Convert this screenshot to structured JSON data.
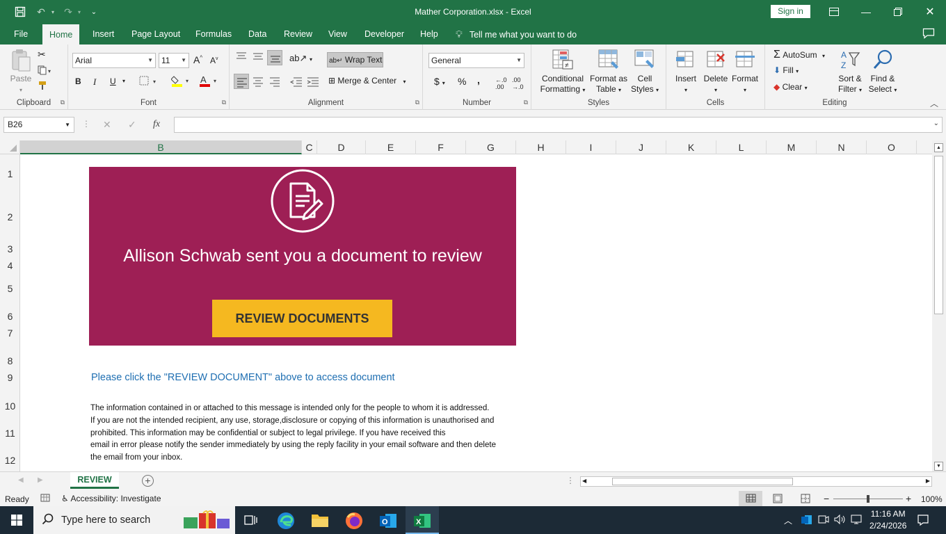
{
  "window": {
    "title": "Mather Corporation.xlsx  -  Excel",
    "sign_in_label": "Sign in"
  },
  "menu_tabs": [
    {
      "label": "File"
    },
    {
      "label": "Home"
    },
    {
      "label": "Insert"
    },
    {
      "label": "Page Layout"
    },
    {
      "label": "Formulas"
    },
    {
      "label": "Data"
    },
    {
      "label": "Review"
    },
    {
      "label": "View"
    },
    {
      "label": "Developer"
    },
    {
      "label": "Help"
    }
  ],
  "tell_me": "Tell me what you want to do",
  "ribbon": {
    "clipboard": {
      "paste": "Paste",
      "label": "Clipboard"
    },
    "font": {
      "name": "Arial",
      "size": "11",
      "bold": "B",
      "italic": "I",
      "underline": "U",
      "label": "Font"
    },
    "alignment": {
      "wrap_text": "Wrap Text",
      "merge_center": "Merge & Center",
      "label": "Alignment"
    },
    "number": {
      "format": "General",
      "currency": "$",
      "percent": "%",
      "comma": ",",
      "label": "Number"
    },
    "styles": {
      "conditional_1": "Conditional",
      "conditional_2": "Formatting",
      "format_table_1": "Format as",
      "format_table_2": "Table",
      "cell_styles_1": "Cell",
      "cell_styles_2": "Styles",
      "label": "Styles"
    },
    "cells": {
      "insert": "Insert",
      "delete": "Delete",
      "format": "Format",
      "label": "Cells"
    },
    "editing": {
      "autosum": "AutoSum",
      "fill": "Fill",
      "clear": "Clear",
      "sort_1": "Sort &",
      "sort_2": "Filter",
      "find_1": "Find &",
      "find_2": "Select",
      "label": "Editing"
    }
  },
  "formula_bar": {
    "name_box": "B26",
    "fx": "fx",
    "value": ""
  },
  "columns": [
    "B",
    "C",
    "D",
    "E",
    "F",
    "G",
    "H",
    "I",
    "J",
    "K",
    "L",
    "M",
    "N",
    "O"
  ],
  "active_column": "B",
  "rows": [
    "1",
    "2",
    "3",
    "4",
    "5",
    "6",
    "7",
    "8",
    "9",
    "10",
    "11",
    "12"
  ],
  "sheet_content": {
    "banner_title": "Allison Schwab sent you a document to review",
    "banner_color": "#9e1f55",
    "button_label": "REVIEW DOCUMENTS",
    "button_color": "#f5b820",
    "click_instruction": "Please click the \"REVIEW DOCUMENT\" above to access document",
    "disclaimer_lines": [
      "The information contained in or attached to this message is intended only for the people to whom it is addressed.",
      "If you are not the intended recipient, any use, storage,disclosure or copying of this information is unauthorised and",
      "prohibited. This information may be confidential or subject to legal privilege. If you have received this",
      "email in error please notify the sender immediately by using the reply facility in your email software and then delete",
      "the email from your inbox."
    ]
  },
  "sheet_tabs": [
    {
      "label": "REVIEW"
    }
  ],
  "status": {
    "ready": "Ready",
    "accessibility": "Accessibility: Investigate",
    "zoom": "100%"
  },
  "taskbar": {
    "search_placeholder": "Type here to search",
    "time": "11:16 AM",
    "date": "2/24/2026"
  },
  "theme": {
    "accent": "#217346"
  }
}
